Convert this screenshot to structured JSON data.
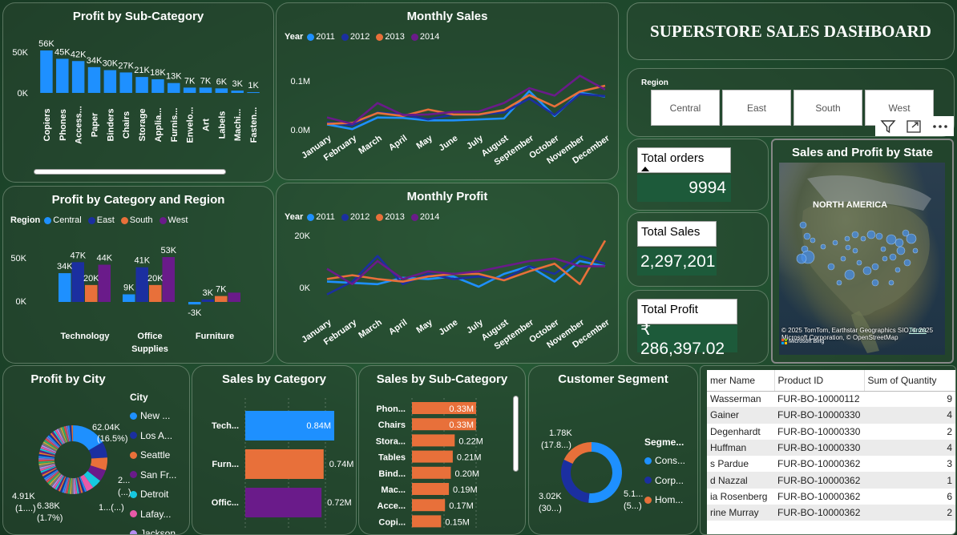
{
  "header": {
    "title": "SUPERSTORE SALES DASHBOARD"
  },
  "profit_sub": {
    "title": "Profit by Sub-Category",
    "y_ticks": [
      "50K",
      "0K"
    ],
    "labels": [
      "56K",
      "45K",
      "42K",
      "34K",
      "30K",
      "27K",
      "21K",
      "18K",
      "13K",
      "7K",
      "7K",
      "6K",
      "3K",
      "1K"
    ],
    "categories": [
      "Copiers",
      "Phones",
      "Access...",
      "Paper",
      "Binders",
      "Chairs",
      "Storage",
      "Applia...",
      "Furnis...",
      "Envelo...",
      "Art",
      "Labels",
      "Machi...",
      "Fasten..."
    ],
    "values": [
      56,
      45,
      42,
      34,
      30,
      27,
      21,
      18,
      13,
      7,
      7,
      6,
      3,
      1
    ]
  },
  "monthly_sales": {
    "title": "Monthly Sales",
    "legend_title": "Year",
    "years": [
      "2011",
      "2012",
      "2013",
      "2014"
    ],
    "colors": [
      "#1e90ff",
      "#1b2fa0",
      "#e8703a",
      "#6a1b8a"
    ],
    "y_ticks": [
      "0.1M",
      "0.0M"
    ],
    "months": [
      "January",
      "February",
      "March",
      "April",
      "May",
      "June",
      "July",
      "August",
      "September",
      "October",
      "November",
      "December"
    ],
    "series": [
      [
        14,
        4.5,
        28,
        27,
        22,
        22,
        24,
        26,
        81,
        31,
        78,
        70
      ],
      [
        18,
        12,
        38,
        34,
        24,
        34,
        34,
        38,
        66,
        33,
        75,
        71
      ],
      [
        15,
        17,
        37,
        31,
        44,
        34,
        34,
        43,
        73,
        50,
        80,
        92
      ],
      [
        28,
        15,
        57,
        33,
        34,
        39,
        40,
        57,
        87,
        72,
        112,
        84
      ]
    ]
  },
  "monthly_profit": {
    "title": "Monthly Profit",
    "legend_title": "Year",
    "y_ticks": [
      "20K",
      "0K"
    ],
    "months": [
      "January",
      "February",
      "March",
      "April",
      "May",
      "June",
      "July",
      "August",
      "September",
      "October",
      "November",
      "December"
    ],
    "series": [
      [
        2,
        1.5,
        1,
        3.5,
        3,
        4,
        0,
        5,
        8,
        2,
        10,
        8
      ],
      [
        -3,
        2,
        12,
        1,
        5,
        3,
        4,
        3,
        8,
        5,
        12,
        9
      ],
      [
        3,
        4.5,
        3,
        2,
        4,
        5,
        5,
        2.5,
        6,
        9,
        1,
        18
      ],
      [
        7,
        1,
        10,
        3,
        6,
        5,
        6,
        8,
        10,
        11,
        8,
        8
      ]
    ]
  },
  "cat_region": {
    "title": "Profit by Category and Region",
    "legend_title": "Region",
    "regions": [
      "Central",
      "East",
      "South",
      "West"
    ],
    "colors": [
      "#1e90ff",
      "#1b2fa0",
      "#e8703a",
      "#6a1b8a"
    ],
    "y_ticks": [
      "50K",
      "0K"
    ],
    "categories": [
      "Technology",
      "Office Supplies",
      "Furniture"
    ],
    "values": [
      [
        34,
        47,
        20,
        44
      ],
      [
        9,
        41,
        20,
        53
      ],
      [
        -3,
        3,
        7,
        11
      ]
    ],
    "labels": [
      [
        "34K",
        "47K",
        "20K",
        "44K"
      ],
      [
        "9K",
        "41K",
        "20K",
        "53K"
      ],
      [
        "-3K",
        "3K",
        "7K",
        ""
      ]
    ]
  },
  "region_slicer": {
    "title": "Region",
    "options": [
      "Central",
      "East",
      "South",
      "West"
    ]
  },
  "kpis": {
    "orders_label": "Total orders",
    "orders_value": "9994",
    "sales_label": "Total Sales",
    "sales_value": "2,297,201",
    "profit_label": "Total Profit",
    "profit_value": "₹ 286,397.02"
  },
  "state_map": {
    "title": "Sales and Profit by State",
    "region_label": "NORTH AMERICA",
    "attribution": "© 2025 TomTom, Earthstar Geographics SIO, © 2025 Microsoft Corporation, © OpenStreetMap",
    "terms": "Terms",
    "bing": "Microsoft Bing"
  },
  "profit_city": {
    "title": "Profit by City",
    "legend_title": "City",
    "cities": [
      "New ...",
      "Los A...",
      "Seattle",
      "San Fr...",
      "Detroit",
      "Lafay...",
      "Jackson"
    ],
    "colors": [
      "#1e90ff",
      "#1b2fa0",
      "#e8703a",
      "#6a1b8a",
      "#16c8e0",
      "#e85aa8",
      "#b38cf0"
    ],
    "label_top": "62.04K",
    "label_top_pct": "(16.5%)",
    "label_left": "4.91K",
    "label_left_pct": "(1....)",
    "label_bottom": "6.38K",
    "label_bottom_pct": "(1.7%)",
    "label_right1": "2...",
    "label_right1b": "(...)",
    "label_right2": "1...(...)"
  },
  "sales_category": {
    "title": "Sales by Category",
    "categories": [
      "Tech...",
      "Furn...",
      "Offic..."
    ],
    "values": [
      0.84,
      0.74,
      0.72
    ],
    "labels": [
      "0.84M",
      "0.74M",
      "0.72M"
    ],
    "colors": [
      "#1e90ff",
      "#e8703a",
      "#6a1b8a"
    ]
  },
  "sales_sub": {
    "title": "Sales by Sub-Category",
    "categories": [
      "Phon...",
      "Chairs",
      "Stora...",
      "Tables",
      "Bind...",
      "Mac...",
      "Acce...",
      "Copi..."
    ],
    "values": [
      0.33,
      0.33,
      0.22,
      0.21,
      0.2,
      0.19,
      0.17,
      0.15
    ],
    "labels": [
      "0.33M",
      "0.33M",
      "0.22M",
      "0.21M",
      "0.20M",
      "0.19M",
      "0.17M",
      "0.15M"
    ]
  },
  "segment": {
    "title": "Customer Segment",
    "legend_title": "Segme...",
    "segments": [
      "Cons...",
      "Corp...",
      "Hom..."
    ],
    "colors": [
      "#1e90ff",
      "#1b2fa0",
      "#e8703a"
    ],
    "values": [
      51,
      30,
      17.8
    ],
    "label_a": "1.78K",
    "label_a2": "(17.8...)",
    "label_b": "3.02K",
    "label_b2": "(30...)",
    "label_c": "5.1...",
    "label_c2": "(5...)"
  },
  "table": {
    "headers": [
      "mer Name",
      "Product ID",
      "Sum of Quantity"
    ],
    "rows": [
      [
        "Wasserman",
        "FUR-BO-10000112",
        "9"
      ],
      [
        "Gainer",
        "FUR-BO-10000330",
        "4"
      ],
      [
        "Degenhardt",
        "FUR-BO-10000330",
        "2"
      ],
      [
        "Huffman",
        "FUR-BO-10000330",
        "4"
      ],
      [
        "s Pardue",
        "FUR-BO-10000362",
        "3"
      ],
      [
        "d Nazzal",
        "FUR-BO-10000362",
        "1"
      ],
      [
        "ia Rosenberg",
        "FUR-BO-10000362",
        "6"
      ],
      [
        "rine Murray",
        "FUR-BO-10000362",
        "2"
      ]
    ]
  }
}
